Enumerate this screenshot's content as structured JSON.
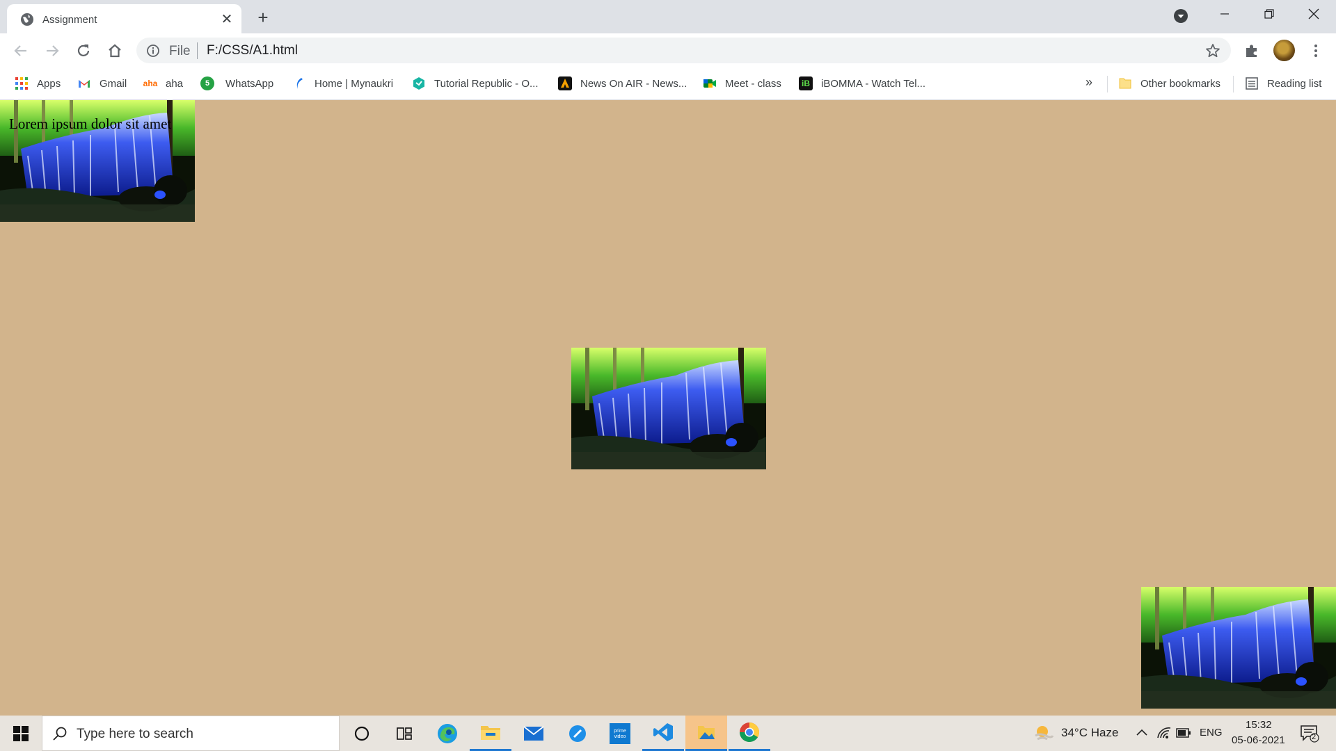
{
  "browser": {
    "tab_title": "Assignment",
    "omnibox": {
      "scheme_label": "File",
      "url": "F:/CSS/A1.html"
    },
    "bookmarks": [
      {
        "label": "Apps",
        "icon": "apps-grid-icon"
      },
      {
        "label": "Gmail",
        "icon": "gmail-icon"
      },
      {
        "label": "aha",
        "icon": "aha-icon"
      },
      {
        "label": "WhatsApp",
        "icon": "whatsapp-icon"
      },
      {
        "label": "Home | Mynaukri",
        "icon": "mynaukri-icon"
      },
      {
        "label": "Tutorial Republic - O...",
        "icon": "tutorial-republic-icon"
      },
      {
        "label": "News On AIR - News...",
        "icon": "news-on-air-icon"
      },
      {
        "label": "Meet - class",
        "icon": "google-meet-icon"
      },
      {
        "label": "iBOMMA - Watch Tel...",
        "icon": "ibomma-icon"
      }
    ],
    "other_bookmarks": "Other bookmarks",
    "reading_list": "Reading list",
    "more_bookmarks": "»"
  },
  "page": {
    "background_color": "#d2b48c",
    "lorem_text": "Lorem ipsum dolor sit amet",
    "images": [
      {
        "name": "waterfall-image-top-left",
        "subject": "waterfall"
      },
      {
        "name": "waterfall-image-center",
        "subject": "waterfall"
      },
      {
        "name": "waterfall-image-bottom-right",
        "subject": "waterfall"
      }
    ]
  },
  "taskbar": {
    "search_placeholder": "Type here to search",
    "weather": "34°C  Haze",
    "language": "ENG",
    "time": "15:32",
    "date": "05-06-2021",
    "notification_count": "2",
    "pinned_apps": [
      "cortana-icon",
      "task-view-icon",
      "edge-icon",
      "file-explorer-icon",
      "mail-icon",
      "paint-icon",
      "prime-video-icon",
      "vscode-icon",
      "photos-icon",
      "chrome-icon"
    ]
  }
}
